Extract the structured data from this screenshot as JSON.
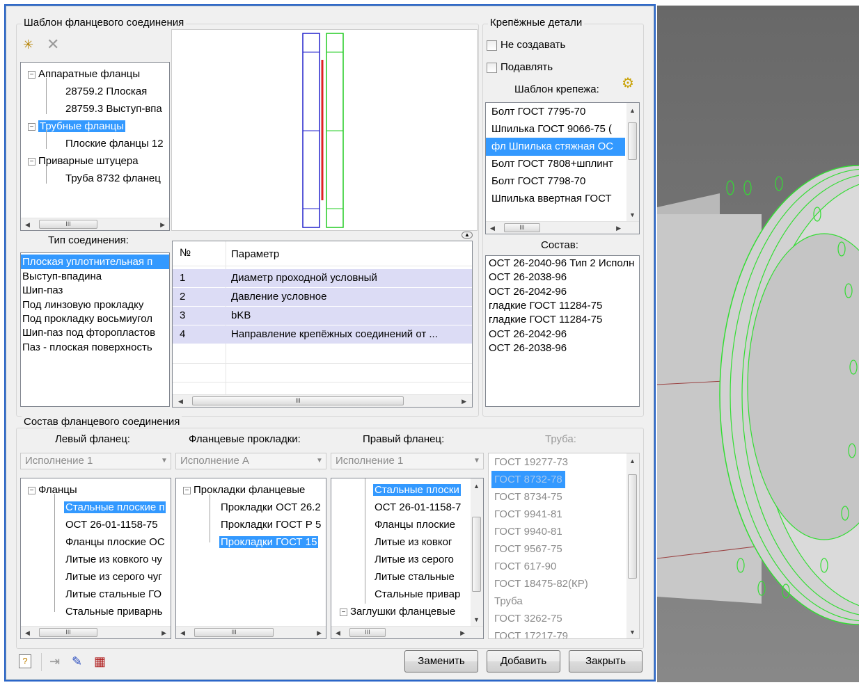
{
  "template_group": {
    "legend": "Шаблон фланцевого соединения",
    "tree": [
      "Аппаратные фланцы",
      "28759.2 Плоская",
      "28759.3 Выступ-впа",
      "Трубные фланцы",
      "Плоские фланцы 12",
      "Приварные штуцера",
      "Труба 8732 фланец"
    ]
  },
  "connection": {
    "label": "Тип соединения:",
    "items": [
      "Плоская уплотнительная п",
      "Выступ-впадина",
      "Шип-паз",
      "Под линзовую прокладку",
      "Под прокладку восьмиугол",
      "Шип-паз под фторопластов",
      "Паз - плоская поверхность"
    ]
  },
  "params": {
    "col_num": "№",
    "col_param": "Параметр",
    "rows": [
      {
        "n": "1",
        "p": "Диаметр проходной условный"
      },
      {
        "n": "2",
        "p": "Давление условное"
      },
      {
        "n": "3",
        "p": "bKB"
      },
      {
        "n": "4",
        "p": "Направление крепёжных соединений от ..."
      }
    ]
  },
  "fasteners": {
    "legend": "Крепёжные детали",
    "no_create": "Не создавать",
    "suppress": "Подавлять",
    "template_label": "Шаблон крепежа:",
    "items": [
      "Болт ГОСТ 7795-70",
      "Шпилька ГОСТ 9066-75 (",
      "фл Шпилька стяжная ОС",
      "Болт ГОСТ 7808+шплинт",
      "Болт ГОСТ 7798-70",
      "Шпилька ввертная ГОСТ"
    ],
    "composition_label": "Состав:",
    "composition": [
      "ОСТ 26-2040-96 Тип 2 Исполн",
      "ОСТ 26-2038-96",
      "ОСТ 26-2042-96",
      "гладкие ГОСТ 11284-75",
      "гладкие ГОСТ 11284-75",
      "ОСТ 26-2042-96",
      "ОСТ 26-2038-96"
    ]
  },
  "composition_group": {
    "legend": "Состав фланцевого соединения",
    "left": {
      "label": "Левый фланец:",
      "combo": "Исполнение 1",
      "tree": [
        "Фланцы",
        "Стальные плоские п",
        "ОСТ 26-01-1158-75",
        "Фланцы плоские ОС",
        "Литые из ковкого чу",
        "Литые из серого чуг",
        "Литые стальные ГО",
        "Стальные приварнь"
      ]
    },
    "gasket": {
      "label": "Фланцевые прокладки:",
      "combo": "Исполнение А",
      "tree": [
        "Прокладки фланцевые",
        "Прокладки ОСТ 26.2",
        "Прокладки ГОСТ Р 5",
        "Прокладки ГОСТ 15"
      ]
    },
    "right": {
      "label": "Правый фланец:",
      "combo": "Исполнение 1",
      "tree": [
        "Стальные плоски",
        "ОСТ 26-01-1158-7",
        "Фланцы плоские",
        "Литые из ковког",
        "Литые из серого",
        "Литые стальные",
        "Стальные привар",
        "Заглушки фланцевые"
      ]
    },
    "pipe": {
      "label": "Труба:",
      "items": [
        "ГОСТ 19277-73",
        "ГОСТ 8732-78",
        "ГОСТ 8734-75",
        "ГОСТ 9941-81",
        "ГОСТ 9940-81",
        "ГОСТ 9567-75",
        "ГОСТ 617-90",
        "ГОСТ 18475-82(КР)",
        "Труба",
        "ГОСТ 3262-75",
        "ГОСТ 17217-79"
      ]
    }
  },
  "buttons": {
    "replace": "Заменить",
    "add": "Добавить",
    "close": "Закрыть"
  },
  "scroll_glyph": "III",
  "colors": {
    "selection": "#3399ff",
    "params_row": "#dcdcf5",
    "preview_blue": "#2222cc",
    "preview_green": "#22cc22",
    "preview_red": "#dd2222",
    "model_green": "#33dd33"
  }
}
